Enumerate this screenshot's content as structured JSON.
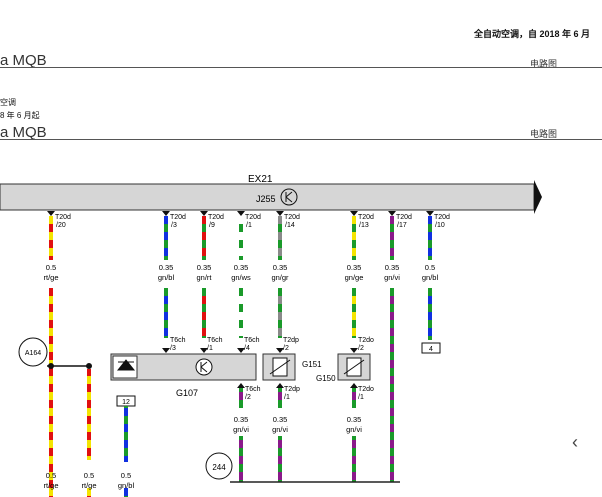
{
  "header": {
    "title_right": "全自动空调，自 2018 年 6 月",
    "model_line_1": "a MQB",
    "type_1": "电路图",
    "subtitle_1": "空调",
    "subtitle_2": "8 年 6 月起",
    "model_line_2": "a MQB",
    "type_2": "电路图"
  },
  "diagram": {
    "bus_label": "EX21",
    "module_label": "J255",
    "wires": [
      {
        "conn_top": "T20d",
        "pin_top": "/20",
        "size": "0.5",
        "color": "rt/ge"
      },
      {
        "conn_top": "T20d",
        "pin_top": "/3",
        "size": "0.35",
        "color": "gn/bl",
        "conn_bot": "T6ch",
        "pin_bot": "/3"
      },
      {
        "conn_top": "T20d",
        "pin_top": "/9",
        "size": "0.35",
        "color": "gn/rt",
        "conn_bot": "T6ch",
        "pin_bot": "/1"
      },
      {
        "conn_top": "T20d",
        "pin_top": "/1",
        "size": "0.35",
        "color": "gn/ws",
        "conn_bot": "T6ch",
        "pin_bot": "/4"
      },
      {
        "conn_top": "T20d",
        "pin_top": "/14",
        "size": "0.35",
        "color": "gn/gr",
        "conn_bot": "T2dp",
        "pin_bot": "/2"
      },
      {
        "conn_top": "T20d",
        "pin_top": "/13",
        "size": "0.35",
        "color": "gn/ge",
        "conn_bot": "T2do",
        "pin_bot": "/2"
      },
      {
        "conn_top": "T20d",
        "pin_top": "/17",
        "size": "0.35",
        "color": "gn/vi"
      },
      {
        "conn_top": "T20d",
        "pin_top": "/10",
        "size": "0.5",
        "color": "gn/bl"
      }
    ],
    "lower_wires": [
      {
        "conn": "T6ch",
        "pin": "/2",
        "size": "0.35",
        "color": "gn/vi"
      },
      {
        "conn": "T2dp",
        "pin": "/1",
        "size": "0.35",
        "color": "gn/vi"
      },
      {
        "conn": "T2do",
        "pin": "/1",
        "size": "0.35",
        "color": "gn/vi"
      }
    ],
    "bottom_wires": [
      {
        "size": "0.5",
        "color": "rt/ge"
      },
      {
        "size": "0.5",
        "color": "rt/ge"
      },
      {
        "size": "0.5",
        "color": "gn/bl"
      }
    ],
    "components": {
      "a164": "A164",
      "g107": "G107",
      "g151": "G151",
      "g150": "G150",
      "ground": "244",
      "ref_4": "4",
      "ref_12": "12"
    },
    "colors": {
      "green": "#1a9a2a",
      "red": "#e01010",
      "yellow": "#f4e400",
      "blue": "#1030e0",
      "white": "#ffffff",
      "grey": "#8a8a8a",
      "violet": "#8a1a8a"
    }
  },
  "nav": {
    "prev_icon": "chevron-left-icon"
  }
}
